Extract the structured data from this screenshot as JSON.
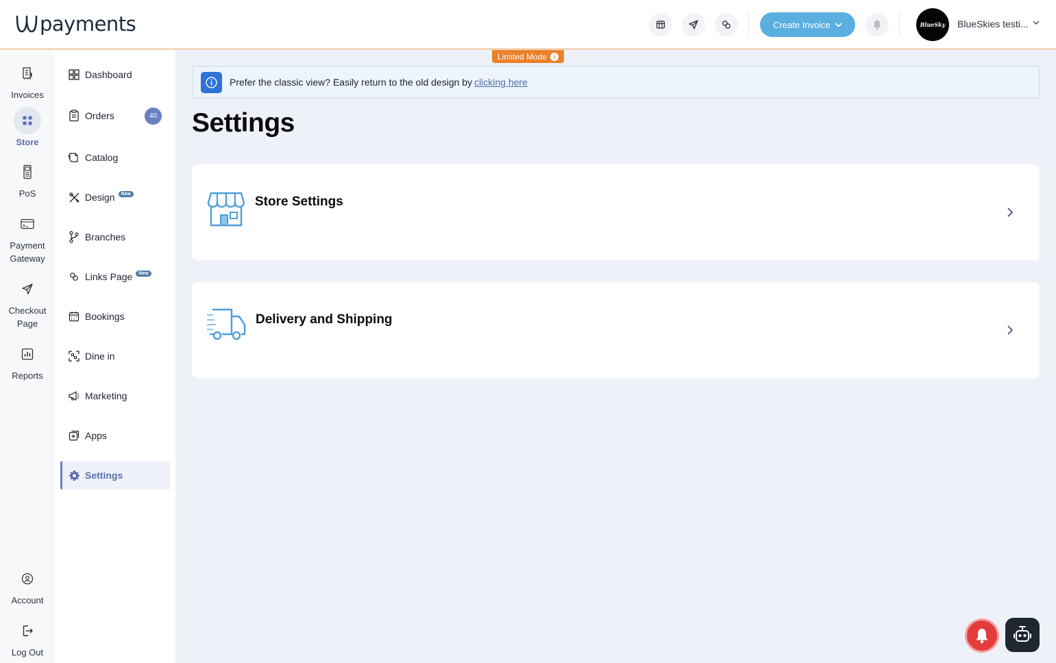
{
  "header": {
    "logo_text": "payments",
    "create_button": "Create Invoice",
    "account_name": "BlueSkies testi...",
    "avatar_text": "BlueSky",
    "icons": [
      "store-icon",
      "send-icon",
      "links-icon",
      "bell-icon"
    ]
  },
  "rail": {
    "items": [
      {
        "label": "Invoices",
        "icon": "invoice-icon"
      },
      {
        "label": "Store",
        "icon": "store-grid-icon",
        "active": true
      },
      {
        "label": "PoS",
        "icon": "pos-icon"
      },
      {
        "label": "Payment Gateway",
        "icon": "payment-gateway-icon"
      },
      {
        "label": "Checkout Page",
        "icon": "checkout-send-icon"
      },
      {
        "label": "Reports",
        "icon": "reports-icon"
      }
    ],
    "bottom": [
      {
        "label": "Account",
        "icon": "account-icon"
      },
      {
        "label": "Log Out",
        "icon": "logout-icon"
      }
    ]
  },
  "sidebar": {
    "items": [
      {
        "label": "Dashboard"
      },
      {
        "label": "Orders",
        "count": "40"
      },
      {
        "label": "Catalog"
      },
      {
        "label": "Design",
        "badge": "New"
      },
      {
        "label": "Branches"
      },
      {
        "label": "Links Page",
        "badge": "New"
      },
      {
        "label": "Bookings"
      },
      {
        "label": "Dine in"
      },
      {
        "label": "Marketing"
      },
      {
        "label": "Apps"
      },
      {
        "label": "Settings",
        "active": true
      }
    ]
  },
  "main": {
    "limited_mode": "Limited Mode",
    "banner_text": "Prefer the classic view? Easily return to the old design by",
    "banner_link": "clicking here",
    "title": "Settings",
    "cards": [
      {
        "title": "Store Settings",
        "icon": "storefront-icon"
      },
      {
        "title": "Delivery and Shipping",
        "icon": "delivery-truck-icon"
      }
    ]
  },
  "colors": {
    "accent": "#5aaee0",
    "active_nav": "#5b6fb0",
    "limited_badge": "#e9812a",
    "notification_fab": "#e23c3c"
  }
}
